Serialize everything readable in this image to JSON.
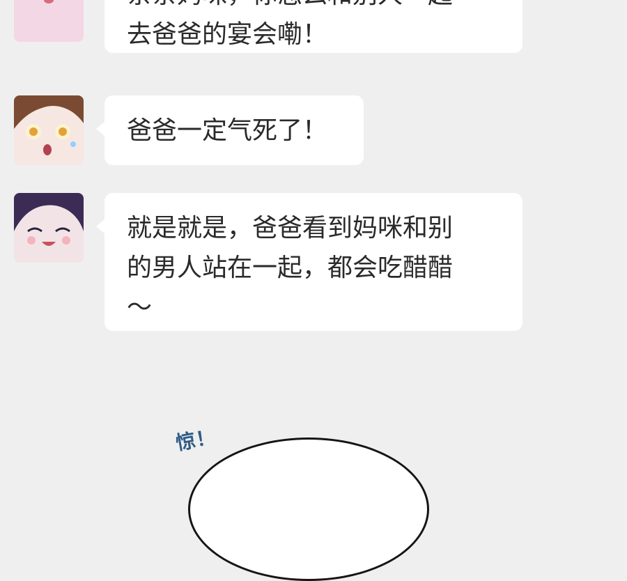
{
  "messages": [
    {
      "avatar": "pink-haired-girl-surprised-avatar",
      "text": "亲亲妈咪，你怎么和别人一起\n去爸爸的宴会嘞！"
    },
    {
      "avatar": "brown-haired-child-shocked-avatar",
      "text": "爸爸一定气死了！"
    },
    {
      "avatar": "dark-haired-child-happy-avatar",
      "text": "就是就是，爸爸看到妈咪和别\n的男人站在一起，都会吃醋醋\n～"
    }
  ],
  "scene": {
    "shock_text": "惊！"
  },
  "colors": {
    "background": "#efefef",
    "bubble": "#ffffff",
    "shock_text": "#2f5d86"
  }
}
